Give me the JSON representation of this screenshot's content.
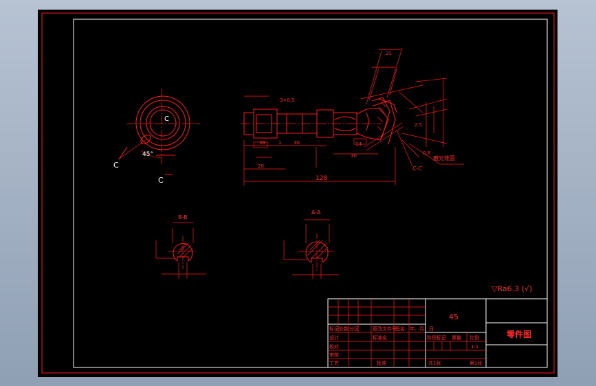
{
  "drawing": {
    "view_label_c1": "C",
    "view_label_c2": "C",
    "view_label_center": "C",
    "angle_45": "45°",
    "dim_128": "128",
    "dim_3x0_5": "3×0.5",
    "dim_20": "20",
    "dim_38": "38",
    "dim_1": "1",
    "dim_30": "30",
    "dim_14": "14",
    "dim_21": "21",
    "dim_2_5": "2.5",
    "dim_0_8": "0.8",
    "label_bb": "B-B",
    "label_aa": "A-A",
    "label_cc": "C-C",
    "label_ground": "磨光锥面",
    "surface_finish": "▽Ra6.3 (√)"
  },
  "title_block": {
    "material": "45",
    "part_name": "零件图",
    "row_headers": [
      "标记",
      "处数",
      "分区",
      "更改文件号",
      "签名",
      "年、月、日"
    ],
    "design": "设计",
    "check": "校对",
    "review": "审核",
    "process": "工艺",
    "standard": "标准化",
    "approve": "批准",
    "stage_mark": "阶段标记",
    "weight": "重量",
    "scale": "比例",
    "scale_value": "1:1",
    "sheet_total": "共1张",
    "sheet_no": "第1张"
  }
}
